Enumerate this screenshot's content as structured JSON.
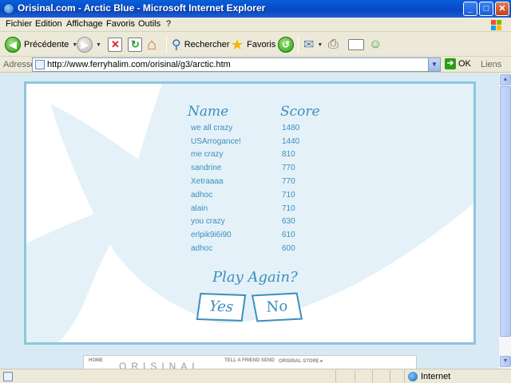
{
  "window": {
    "title": "Orisinal.com - Arctic Blue - Microsoft Internet Explorer",
    "controls": [
      "_",
      "□",
      "✕"
    ]
  },
  "menu": [
    "Fichier",
    "Edition",
    "Affichage",
    "Favoris",
    "Outils",
    "?"
  ],
  "toolbar": {
    "back_label": "Précédente",
    "search_label": "Rechercher",
    "favorites_label": "Favoris"
  },
  "address": {
    "label": "Adresse",
    "url": "http://www.ferryhalim.com/orisinal/g3/arctic.htm",
    "go_label": "OK",
    "links_label": "Liens"
  },
  "game": {
    "name_header": "Name",
    "score_header": "Score",
    "scores": [
      {
        "name": "we all crazy",
        "score": "1480"
      },
      {
        "name": "USArrogance!",
        "score": "1440"
      },
      {
        "name": "me crazy",
        "score": "810"
      },
      {
        "name": "sandrine",
        "score": "770"
      },
      {
        "name": "Xetraaaa",
        "score": "770"
      },
      {
        "name": "adhoc",
        "score": "710"
      },
      {
        "name": "alain",
        "score": "710"
      },
      {
        "name": "you crazy",
        "score": "630"
      },
      {
        "name": "erlpik9i6i90",
        "score": "610"
      },
      {
        "name": "adhoc",
        "score": "600"
      }
    ],
    "play_again": "Play Again?",
    "yes_label": "Yes",
    "no_label": "No"
  },
  "banner": {
    "home": "HOME",
    "logo": "ORISINAL",
    "tell_friend": "TELL A FRIEND",
    "send": "SEND",
    "store": "ORISINAL STORE ▸"
  },
  "status": {
    "zone": "Internet"
  },
  "colors": {
    "titlebar": "#0450d0",
    "game_text": "#3b8fbd",
    "frame_border": "#8ec6df",
    "page_background": "#d8ebf5"
  }
}
